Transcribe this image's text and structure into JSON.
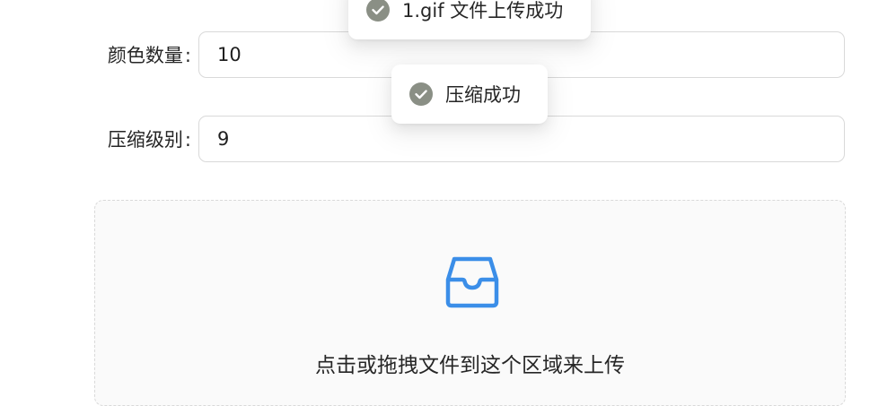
{
  "form": {
    "colors": {
      "label": "颜色数量",
      "colon": ":",
      "value": "10"
    },
    "level": {
      "label": "压缩级别",
      "colon": ":",
      "value": "9"
    }
  },
  "upload": {
    "icon": "inbox-icon",
    "text": "点击或拖拽文件到这个区域来上传",
    "accent": "#1677ff"
  },
  "toasts": {
    "upload_success": {
      "icon": "check-circle-icon",
      "text": "1.gif 文件上传成功"
    },
    "compress_success": {
      "icon": "check-circle-icon",
      "text": "压缩成功"
    }
  },
  "colors": {
    "toast_icon": "#8a8f85",
    "border": "#d9d9d9"
  }
}
